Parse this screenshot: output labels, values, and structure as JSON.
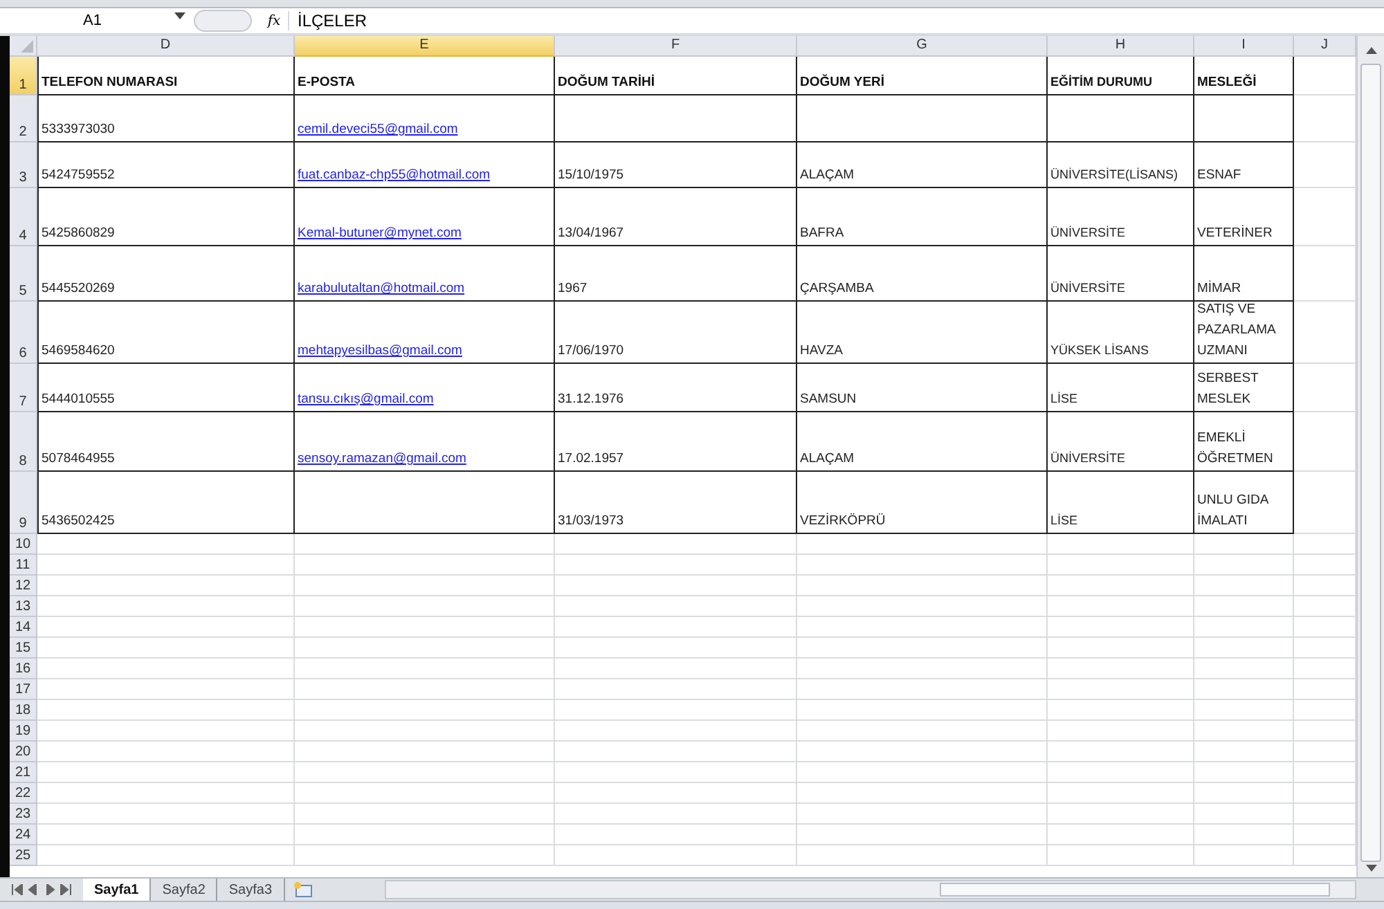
{
  "formula_bar": {
    "name_box": "A1",
    "function_label": "fx",
    "value": "İLÇELER"
  },
  "columns": [
    {
      "label": "D",
      "selected": false
    },
    {
      "label": "E",
      "selected": true
    },
    {
      "label": "F",
      "selected": false
    },
    {
      "label": "G",
      "selected": false
    },
    {
      "label": "H",
      "selected": false
    },
    {
      "label": "I",
      "selected": false
    },
    {
      "label": "J",
      "selected": false
    }
  ],
  "rows": [
    {
      "number": "1",
      "selected": true,
      "kind": "header",
      "cells": [
        "TELEFON NUMARASI",
        "E-POSTA",
        "DOĞUM TARİHİ",
        "DOĞUM YERİ",
        "EĞİTİM DURUMU",
        "MESLEĞİ"
      ]
    },
    {
      "number": "2",
      "selected": false,
      "kind": "data",
      "cells": [
        "5333973030",
        "cemil.deveci55@gmail.com",
        null,
        null,
        null,
        null
      ]
    },
    {
      "number": "3",
      "selected": false,
      "kind": "data",
      "cells": [
        "5424759552",
        "fuat.canbaz-chp55@hotmail.com",
        "15/10/1975",
        "ALAÇAM",
        "ÜNİVERSİTE(LİSANS)",
        "ESNAF"
      ]
    },
    {
      "number": "4",
      "selected": false,
      "kind": "data",
      "cells": [
        "5425860829",
        "Kemal-butuner@mynet.com",
        "13/04/1967",
        "BAFRA",
        "ÜNİVERSİTE",
        "VETERİNER"
      ]
    },
    {
      "number": "5",
      "selected": false,
      "kind": "data",
      "cells": [
        "5445520269",
        "karabulutaltan@hotmail.com",
        "1967",
        "ÇARŞAMBA",
        "ÜNİVERSİTE",
        "MİMAR"
      ]
    },
    {
      "number": "6",
      "selected": false,
      "kind": "data",
      "cells": [
        "5469584620",
        "mehtapyesilbas@gmail.com",
        "17/06/1970",
        "HAVZA",
        "YÜKSEK LİSANS",
        "SATIŞ VE PAZARLAMA UZMANI"
      ]
    },
    {
      "number": "7",
      "selected": false,
      "kind": "data",
      "cells": [
        "5444010555",
        "tansu.cıkış@gmail.com",
        " 31.12.1976",
        "SAMSUN",
        "LİSE",
        "SERBEST MESLEK"
      ]
    },
    {
      "number": "8",
      "selected": false,
      "kind": "data",
      "cells": [
        "5078464955",
        "sensoy.ramazan@gmail.com",
        " 17.02.1957",
        "ALAÇAM",
        "ÜNİVERSİTE",
        "EMEKLİ ÖĞRETMEN"
      ]
    },
    {
      "number": "9",
      "selected": false,
      "kind": "data",
      "cells": [
        "5436502425",
        null,
        "31/03/1973",
        "VEZİRKÖPRÜ",
        "LİSE",
        "UNLU GIDA İMALATI"
      ]
    }
  ],
  "empty_rows": [
    "10",
    "11",
    "12",
    "13",
    "14",
    "15",
    "16",
    "17",
    "18",
    "19",
    "20",
    "21",
    "22",
    "23",
    "24",
    "25"
  ],
  "sheet_tabs": [
    {
      "label": "Sayfa1",
      "selected": true
    },
    {
      "label": "Sayfa2",
      "selected": false
    },
    {
      "label": "Sayfa3",
      "selected": false
    }
  ]
}
